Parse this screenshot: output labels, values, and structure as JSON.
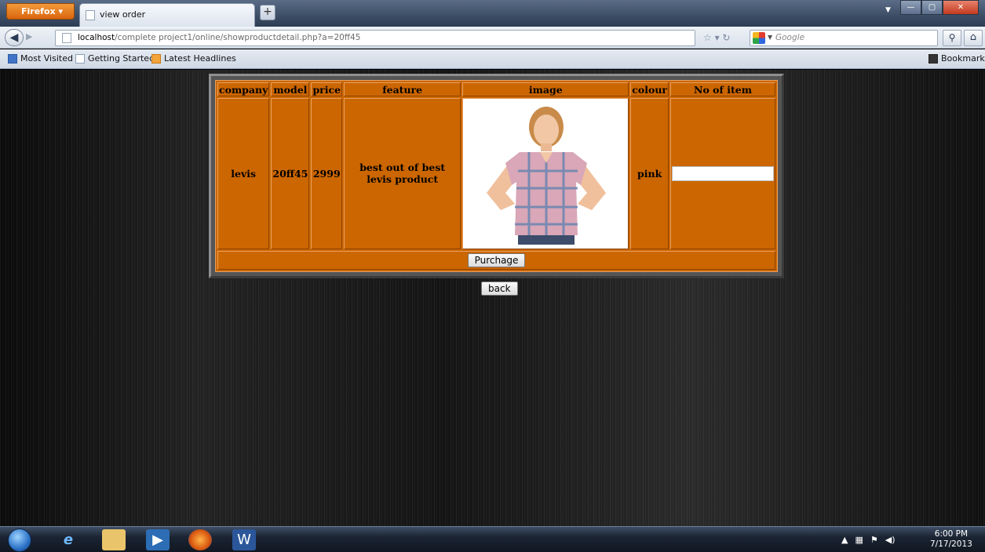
{
  "browser": {
    "app_button": "Firefox",
    "tab_title": "view order",
    "url_host": "localhost",
    "url_path": "/complete project1/online/showproductdetail.php?a=20ff45",
    "search_engine": "Google",
    "bookmarks": [
      "Most Visited",
      "Getting Started",
      "Latest Headlines"
    ],
    "bookmarks_menu": "Bookmarks"
  },
  "table": {
    "headers": [
      "company",
      "model",
      "price",
      "feature",
      "image",
      "colour",
      "No of item"
    ],
    "row": {
      "company": "levis",
      "model": "20ff45",
      "price": "2999",
      "feature": "best out of best levis product",
      "colour": "pink",
      "no_of_item_value": ""
    },
    "purchase_label": "Purchage"
  },
  "back_label": "back",
  "taskbar": {
    "time": "6:00 PM",
    "date": "7/17/2013"
  },
  "colors": {
    "table_bg": "#cc6600",
    "page_bg": "#000000"
  }
}
